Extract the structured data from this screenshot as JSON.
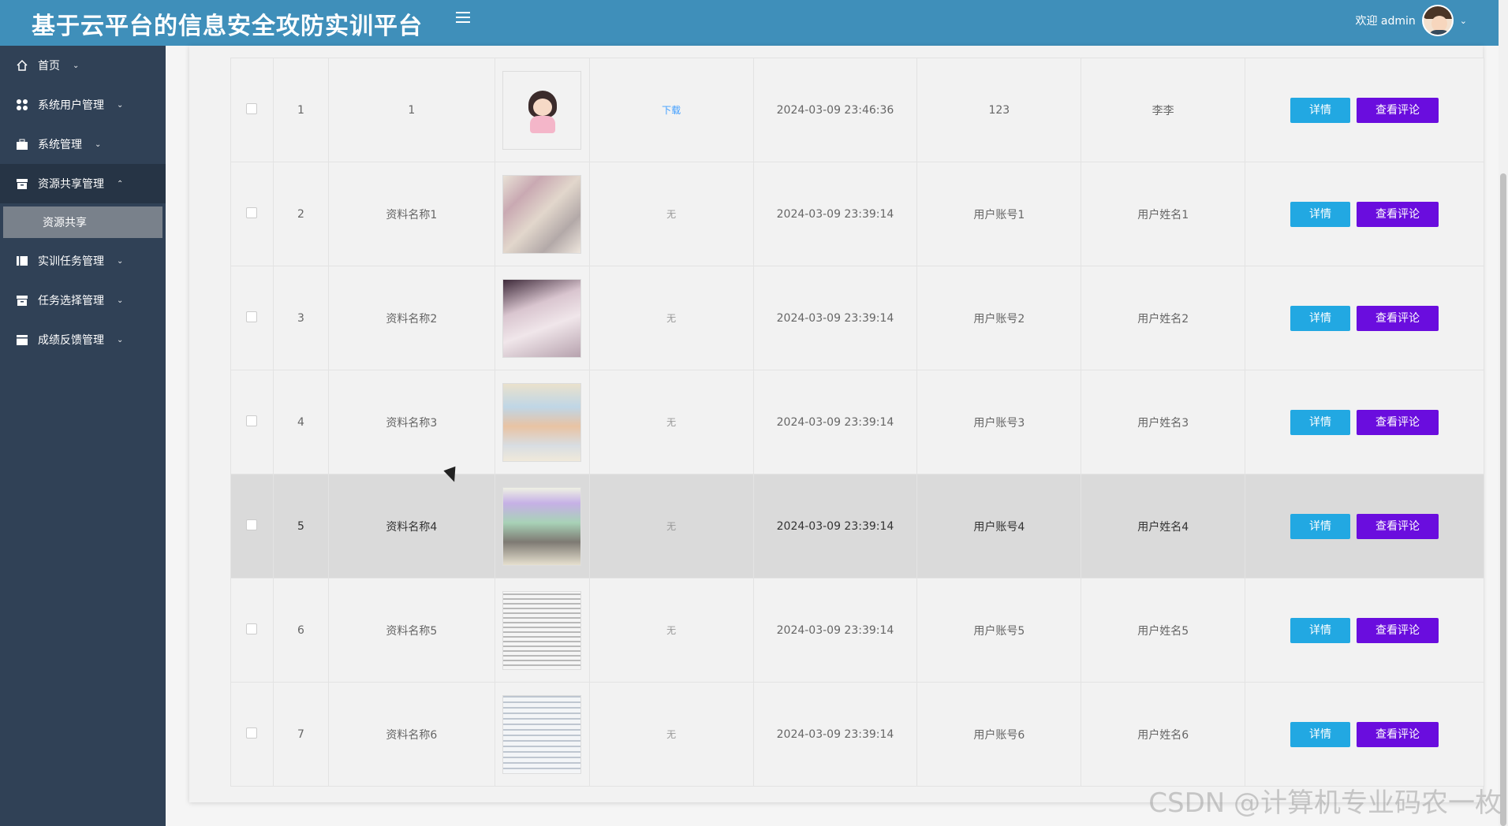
{
  "header": {
    "title": "基于云平台的信息安全攻防实训平台",
    "welcome": "欢迎 admin"
  },
  "sidebar": {
    "items": [
      {
        "label": "首页",
        "icon": "home-icon"
      },
      {
        "label": "系统用户管理",
        "icon": "users-icon"
      },
      {
        "label": "系统管理",
        "icon": "briefcase-icon"
      },
      {
        "label": "资源共享管理",
        "icon": "archive-icon"
      },
      {
        "label": "实训任务管理",
        "icon": "book-icon"
      },
      {
        "label": "任务选择管理",
        "icon": "archive-icon"
      },
      {
        "label": "成绩反馈管理",
        "icon": "calendar-icon"
      }
    ],
    "sub_item": "资源共享"
  },
  "table": {
    "rows": [
      {
        "index": "1",
        "name": "1",
        "file": "下载",
        "time": "2024-03-09 23:46:36",
        "account": "123",
        "username": "李李"
      },
      {
        "index": "2",
        "name": "资料名称1",
        "file": "无",
        "time": "2024-03-09 23:39:14",
        "account": "用户账号1",
        "username": "用户姓名1"
      },
      {
        "index": "3",
        "name": "资料名称2",
        "file": "无",
        "time": "2024-03-09 23:39:14",
        "account": "用户账号2",
        "username": "用户姓名2"
      },
      {
        "index": "4",
        "name": "资料名称3",
        "file": "无",
        "time": "2024-03-09 23:39:14",
        "account": "用户账号3",
        "username": "用户姓名3"
      },
      {
        "index": "5",
        "name": "资料名称4",
        "file": "无",
        "time": "2024-03-09 23:39:14",
        "account": "用户账号4",
        "username": "用户姓名4"
      },
      {
        "index": "6",
        "name": "资料名称5",
        "file": "无",
        "time": "2024-03-09 23:39:14",
        "account": "用户账号5",
        "username": "用户姓名5"
      },
      {
        "index": "7",
        "name": "资料名称6",
        "file": "无",
        "time": "2024-03-09 23:39:14",
        "account": "用户账号6",
        "username": "用户姓名6"
      }
    ],
    "detail_label": "详情",
    "comment_label": "查看评论"
  },
  "watermark": "CSDN @计算机专业码农一枚",
  "colors": {
    "header": "#3f8fba",
    "sidebar": "#304156",
    "detail_button": "#22a8e2",
    "comment_button": "#6a0dde"
  }
}
